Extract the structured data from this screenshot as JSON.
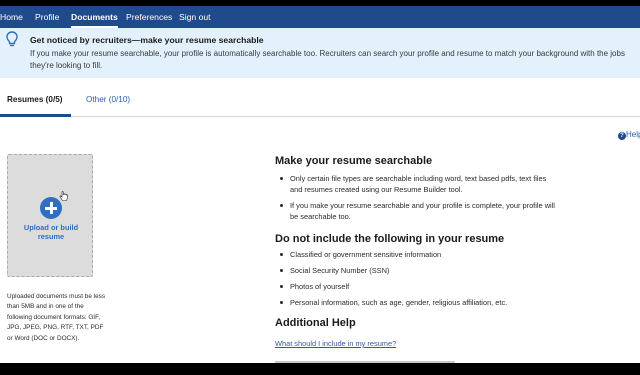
{
  "nav": {
    "items": [
      {
        "label": "Home",
        "active": false
      },
      {
        "label": "Profile",
        "active": false
      },
      {
        "label": "Documents",
        "active": true
      },
      {
        "label": "Preferences",
        "active": false
      },
      {
        "label": "Sign out",
        "active": false
      }
    ]
  },
  "banner": {
    "title": "Get noticed by recruiters—make your resume searchable",
    "body": "If you make your resume searchable, your profile is automatically searchable too. Recruiters can search your profile and resume to match your background with the jobs they're looking to fill."
  },
  "tabs": {
    "resumes": "Resumes (0/5)",
    "other": "Other (0/10)"
  },
  "help": {
    "label": "Help"
  },
  "upload": {
    "label": "Upload or build resume",
    "note": "Uploaded documents must be less than 5MB and in one of the following document formats: GIF, JPG, JPEG, PNG, RTF, TXT, PDF or Word (DOC or DOCX)."
  },
  "searchable": {
    "heading": "Make your resume searchable",
    "bullets": [
      "Only certain file types are searchable including word, text based pdfs, text files and resumes created using our Resume Builder tool.",
      "If you make your resume searchable and your profile is complete, your profile will be searchable too."
    ]
  },
  "exclude": {
    "heading": "Do not include the following in your resume",
    "bullets": [
      "Classified or government sensitive information",
      "Social Security Number (SSN)",
      "Photos of yourself",
      "Personal information, such as age, gender, religious affiliation, etc."
    ]
  },
  "additional": {
    "heading": "Additional Help",
    "link": "What should I include in my resume?"
  },
  "colors": {
    "nav": "#1f4a8c",
    "banner": "#e2f1fb",
    "accent": "#2f6fc0",
    "link": "#2b5ea8"
  }
}
